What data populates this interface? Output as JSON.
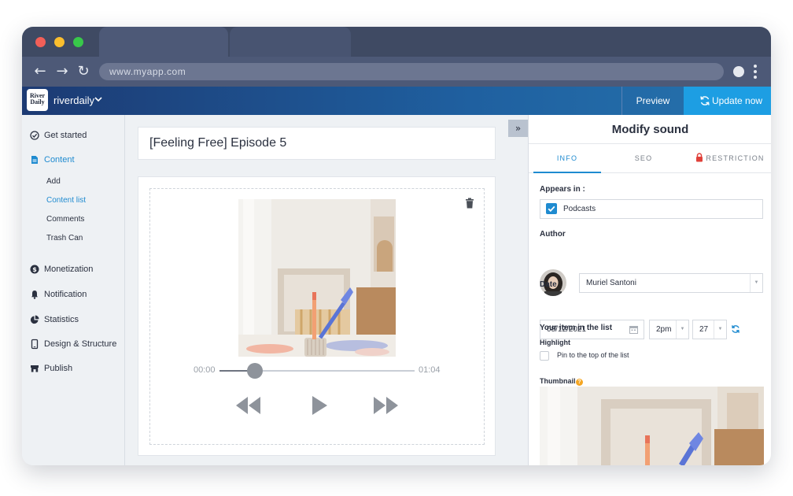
{
  "browser": {
    "url": "www.myapp.com"
  },
  "app": {
    "brand": "riverdaily",
    "logo_text": [
      "River",
      "Daily"
    ],
    "preview_label": "Preview",
    "update_label": "Update now",
    "accent_color": "#1f8bd0"
  },
  "sidebar": {
    "items": [
      {
        "label": "Get started",
        "icon": "check-circle-icon"
      },
      {
        "label": "Content",
        "icon": "document-icon",
        "active": true
      },
      {
        "label": "Monetization",
        "icon": "dollar-icon"
      },
      {
        "label": "Notification",
        "icon": "bell-icon"
      },
      {
        "label": "Statistics",
        "icon": "pie-chart-icon"
      },
      {
        "label": "Design & Structure",
        "icon": "phone-icon"
      },
      {
        "label": "Publish",
        "icon": "store-icon"
      }
    ],
    "sub_items": [
      {
        "label": "Add"
      },
      {
        "label": "Content list",
        "active": true
      },
      {
        "label": "Comments"
      },
      {
        "label": "Trash Can"
      }
    ]
  },
  "main": {
    "title": "[Feeling Free] Episode 5",
    "player": {
      "current_time": "00:00",
      "duration": "01:04",
      "progress": 0.18
    }
  },
  "panel": {
    "title": "Modify sound",
    "tabs": [
      "INFO",
      "SEO",
      "RESTRICTION"
    ],
    "appears_in_label": "Appears in :",
    "appears_in_value": "Podcasts",
    "author_label": "Author",
    "author_value": "Muriel Santoni",
    "date_label": "Date",
    "date_value": "08/12/2021",
    "hour_value": "2pm",
    "minute_value": "27",
    "list_section_label": "Your item in the list",
    "highlight_label": "Highlight",
    "pin_label": "Pin to the top of the list",
    "thumbnail_label": "Thumbnail",
    "help_glyph": "?"
  }
}
